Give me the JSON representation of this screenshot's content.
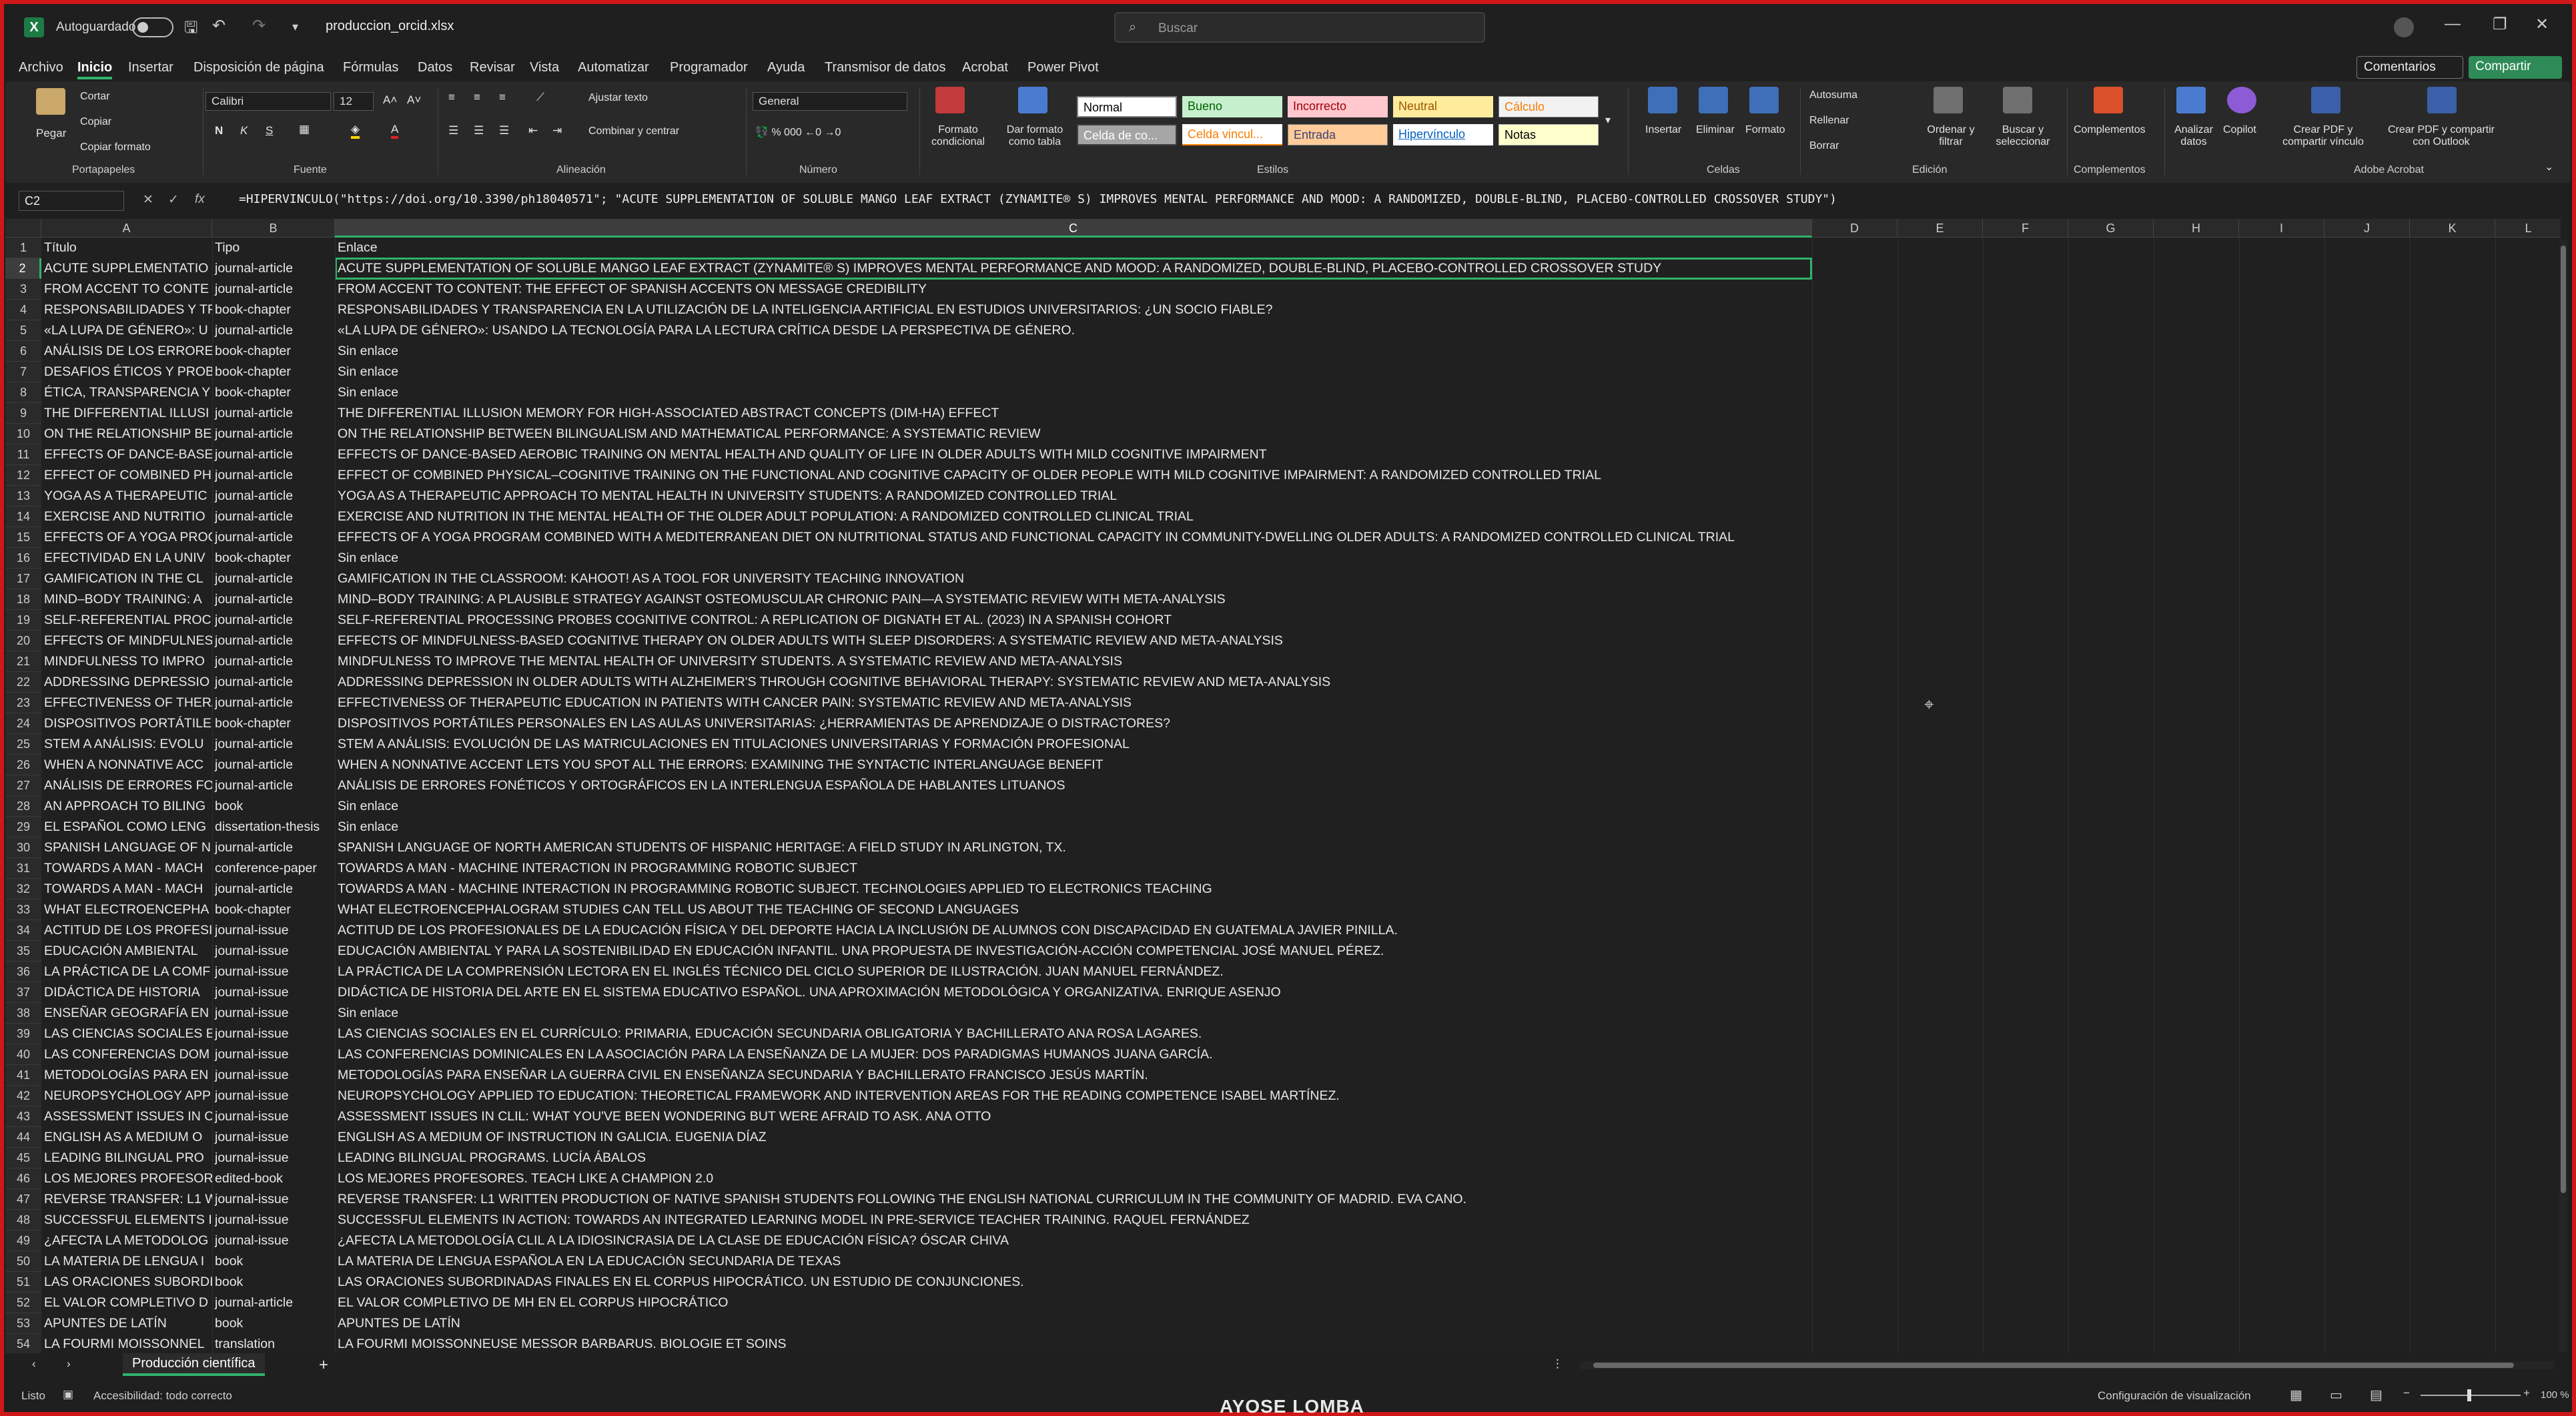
{
  "titlebar": {
    "autosave_label": "Autoguardado",
    "filename": "produccion_orcid.xlsx",
    "search_placeholder": "Buscar"
  },
  "menu": {
    "items": [
      "Archivo",
      "Inicio",
      "Insertar",
      "Disposición de página",
      "Fórmulas",
      "Datos",
      "Revisar",
      "Vista",
      "Automatizar",
      "Programador",
      "Ayuda",
      "Transmisor de datos",
      "Acrobat",
      "Power Pivot"
    ],
    "active": "Inicio",
    "comments_label": "Comentarios",
    "share_label": "Compartir"
  },
  "ribbon": {
    "clipboard": {
      "paste": "Pegar",
      "cut": "Cortar",
      "copy": "Copiar",
      "format_painter": "Copiar formato",
      "label": "Portapapeles"
    },
    "font": {
      "name": "Calibri",
      "size": "12",
      "bold": "N",
      "italic": "K",
      "underline": "S",
      "label": "Fuente"
    },
    "alignment": {
      "wrap": "Ajustar texto",
      "merge": "Combinar y centrar",
      "label": "Alineación"
    },
    "number": {
      "format": "General",
      "label": "Número"
    },
    "styles": {
      "conditional": "Formato condicional",
      "table": "Dar formato como tabla",
      "cells": [
        "Normal",
        "Bueno",
        "Incorrecto",
        "Neutral",
        "Cálculo",
        "Celda de co...",
        "Celda vincul...",
        "Entrada",
        "Hipervínculo",
        "Notas"
      ],
      "label": "Estilos"
    },
    "cells_group": {
      "insert": "Insertar",
      "delete": "Eliminar",
      "format": "Formato",
      "label": "Celdas"
    },
    "editing": {
      "autosum": "Autosuma",
      "fill": "Rellenar",
      "clear": "Borrar",
      "sort": "Ordenar y filtrar",
      "find": "Buscar y seleccionar",
      "label": "Edición"
    },
    "addins": {
      "label": "Complementos",
      "button": "Complementos"
    },
    "analyze": "Analizar datos",
    "copilot": "Copilot",
    "acrobat": {
      "pdf_share": "Crear PDF y compartir vínculo",
      "pdf_outlook": "Crear PDF y compartir con Outlook",
      "label": "Adobe Acrobat"
    }
  },
  "formula_bar": {
    "namebox": "C2",
    "formula": "=HIPERVINCULO(\"https://doi.org/10.3390/ph18040571\"; \"ACUTE SUPPLEMENTATION OF SOLUBLE MANGO LEAF EXTRACT (ZYNAMITE® S) IMPROVES MENTAL PERFORMANCE AND MOOD: A RANDOMIZED, DOUBLE-BLIND, PLACEBO-CONTROLLED CROSSOVER STUDY\")"
  },
  "columns": [
    "A",
    "B",
    "C",
    "D",
    "E",
    "F",
    "G",
    "H",
    "I",
    "J",
    "K",
    "L"
  ],
  "rows": [
    {
      "n": "1",
      "a": "Título",
      "b": "Tipo",
      "c": "Enlace"
    },
    {
      "n": "2",
      "a": "ACUTE SUPPLEMENTATIO",
      "b": "journal-article",
      "c": "ACUTE SUPPLEMENTATION OF SOLUBLE MANGO LEAF EXTRACT (ZYNAMITE® S) IMPROVES MENTAL PERFORMANCE AND MOOD: A RANDOMIZED, DOUBLE-BLIND, PLACEBO-CONTROLLED CROSSOVER STUDY"
    },
    {
      "n": "3",
      "a": "FROM ACCENT TO CONTE",
      "b": "journal-article",
      "c": "FROM ACCENT TO CONTENT: THE EFFECT OF SPANISH ACCENTS ON MESSAGE CREDIBILITY"
    },
    {
      "n": "4",
      "a": "RESPONSABILIDADES Y TF",
      "b": "book-chapter",
      "c": "RESPONSABILIDADES Y TRANSPARENCIA EN LA UTILIZACIÓN DE LA INTELIGENCIA ARTIFICIAL EN ESTUDIOS UNIVERSITARIOS: ¿UN SOCIO FIABLE?"
    },
    {
      "n": "5",
      "a": "«LA LUPA DE GÉNERO»: U",
      "b": "journal-article",
      "c": "«LA LUPA DE GÉNERO»: USANDO LA TECNOLOGÍA PARA LA LECTURA CRÍTICA DESDE LA PERSPECTIVA DE GÉNERO."
    },
    {
      "n": "6",
      "a": "ANÁLISIS DE LOS ERRORE",
      "b": "book-chapter",
      "c": "Sin enlace"
    },
    {
      "n": "7",
      "a": "DESAFIOS ÉTICOS Y PROB",
      "b": "book-chapter",
      "c": "Sin enlace"
    },
    {
      "n": "8",
      "a": "ÉTICA, TRANSPARENCIA Y",
      "b": "book-chapter",
      "c": "Sin enlace"
    },
    {
      "n": "9",
      "a": "THE DIFFERENTIAL ILLUSI",
      "b": "journal-article",
      "c": "THE DIFFERENTIAL ILLUSION MEMORY FOR HIGH-ASSOCIATED ABSTRACT CONCEPTS (DIM-HA) EFFECT"
    },
    {
      "n": "10",
      "a": "ON THE RELATIONSHIP BE",
      "b": "journal-article",
      "c": "ON THE RELATIONSHIP BETWEEN BILINGUALISM AND MATHEMATICAL PERFORMANCE: A SYSTEMATIC REVIEW"
    },
    {
      "n": "11",
      "a": "EFFECTS OF DANCE-BASE",
      "b": "journal-article",
      "c": "EFFECTS OF DANCE-BASED AEROBIC TRAINING ON MENTAL HEALTH AND QUALITY OF LIFE IN OLDER ADULTS WITH MILD COGNITIVE IMPAIRMENT"
    },
    {
      "n": "12",
      "a": "EFFECT OF COMBINED PH",
      "b": "journal-article",
      "c": "EFFECT OF COMBINED PHYSICAL–COGNITIVE TRAINING ON THE FUNCTIONAL AND COGNITIVE CAPACITY OF OLDER PEOPLE WITH MILD COGNITIVE IMPAIRMENT: A RANDOMIZED CONTROLLED TRIAL"
    },
    {
      "n": "13",
      "a": "YOGA AS A THERAPEUTIC",
      "b": "journal-article",
      "c": "YOGA AS A THERAPEUTIC APPROACH TO MENTAL HEALTH IN UNIVERSITY STUDENTS: A RANDOMIZED CONTROLLED TRIAL"
    },
    {
      "n": "14",
      "a": "EXERCISE AND NUTRITIO",
      "b": "journal-article",
      "c": "EXERCISE AND NUTRITION IN THE MENTAL HEALTH OF THE OLDER ADULT POPULATION: A RANDOMIZED CONTROLLED CLINICAL TRIAL"
    },
    {
      "n": "15",
      "a": "EFFECTS OF A YOGA PROG",
      "b": "journal-article",
      "c": "EFFECTS OF A YOGA PROGRAM COMBINED WITH A MEDITERRANEAN DIET ON NUTRITIONAL STATUS AND FUNCTIONAL CAPACITY IN COMMUNITY-DWELLING OLDER ADULTS: A RANDOMIZED CONTROLLED CLINICAL TRIAL"
    },
    {
      "n": "16",
      "a": "EFECTIVIDAD EN LA  UNIV",
      "b": "book-chapter",
      "c": "Sin enlace"
    },
    {
      "n": "17",
      "a": "GAMIFICATION IN THE CL",
      "b": "journal-article",
      "c": "GAMIFICATION IN THE CLASSROOM: KAHOOT! AS A TOOL FOR UNIVERSITY TEACHING INNOVATION"
    },
    {
      "n": "18",
      "a": "MIND–BODY TRAINING: A",
      "b": "journal-article",
      "c": "MIND–BODY TRAINING: A PLAUSIBLE STRATEGY AGAINST OSTEOMUSCULAR CHRONIC PAIN—A SYSTEMATIC REVIEW WITH META-ANALYSIS"
    },
    {
      "n": "19",
      "a": "SELF-REFERENTIAL PROCE",
      "b": "journal-article",
      "c": "SELF-REFERENTIAL PROCESSING PROBES COGNITIVE CONTROL: A REPLICATION OF DIGNATH ET AL. (2023) IN A SPANISH COHORT"
    },
    {
      "n": "20",
      "a": "EFFECTS OF MINDFULNES",
      "b": "journal-article",
      "c": "EFFECTS OF MINDFULNESS-BASED COGNITIVE THERAPY ON OLDER ADULTS WITH SLEEP DISORDERS: A SYSTEMATIC REVIEW AND META-ANALYSIS"
    },
    {
      "n": "21",
      "a": "MINDFULNESS TO IMPRO",
      "b": "journal-article",
      "c": "MINDFULNESS TO IMPROVE THE MENTAL HEALTH OF UNIVERSITY STUDENTS. A SYSTEMATIC REVIEW AND META-ANALYSIS"
    },
    {
      "n": "22",
      "a": "ADDRESSING DEPRESSIO",
      "b": "journal-article",
      "c": "ADDRESSING DEPRESSION IN OLDER ADULTS WITH ALZHEIMER'S THROUGH COGNITIVE BEHAVIORAL THERAPY: SYSTEMATIC REVIEW AND META-ANALYSIS"
    },
    {
      "n": "23",
      "a": "EFFECTIVENESS OF THER/",
      "b": "journal-article",
      "c": "EFFECTIVENESS OF THERAPEUTIC EDUCATION IN PATIENTS WITH CANCER PAIN: SYSTEMATIC REVIEW AND META-ANALYSIS"
    },
    {
      "n": "24",
      "a": " DISPOSITIVOS PORTÁTILE",
      "b": "book-chapter",
      "c": " DISPOSITIVOS PORTÁTILES PERSONALES EN LAS AULAS UNIVERSITARIAS: ¿HERRAMIENTAS DE APRENDIZAJE O DISTRACTORES?"
    },
    {
      "n": "25",
      "a": "STEM A ANÁLISIS: EVOLU",
      "b": "journal-article",
      "c": "STEM A ANÁLISIS: EVOLUCIÓN DE LAS MATRICULACIONES EN TITULACIONES UNIVERSITARIAS Y FORMACIÓN PROFESIONAL"
    },
    {
      "n": "26",
      "a": "WHEN A NONNATIVE ACC",
      "b": "journal-article",
      "c": "WHEN A NONNATIVE ACCENT LETS YOU SPOT ALL THE ERRORS: EXAMINING THE SYNTACTIC INTERLANGUAGE BENEFIT"
    },
    {
      "n": "27",
      "a": "ANÁLISIS DE ERRORES FO",
      "b": "journal-article",
      "c": "ANÁLISIS DE ERRORES FONÉTICOS Y ORTOGRÁFICOS EN LA INTERLENGUA ESPAÑOLA DE HABLANTES LITUANOS"
    },
    {
      "n": "28",
      "a": "AN APPROACH TO BILING",
      "b": "book",
      "c": "Sin enlace"
    },
    {
      "n": "29",
      "a": "EL ESPAÑOL COMO LENG",
      "b": "dissertation-thesis",
      "c": "Sin enlace"
    },
    {
      "n": "30",
      "a": "SPANISH LANGUAGE OF N",
      "b": "journal-article",
      "c": "SPANISH LANGUAGE OF NORTH AMERICAN STUDENTS OF HISPANIC HERITAGE: A FIELD STUDY IN ARLINGTON,   TX."
    },
    {
      "n": "31",
      "a": "TOWARDS A MAN - MACH",
      "b": "conference-paper",
      "c": "TOWARDS A MAN - MACHINE INTERACTION IN PROGRAMMING ROBOTIC SUBJECT"
    },
    {
      "n": "32",
      "a": "TOWARDS A MAN - MACH",
      "b": "journal-article",
      "c": "TOWARDS A MAN - MACHINE INTERACTION IN PROGRAMMING ROBOTIC SUBJECT. TECHNOLOGIES APPLIED TO ELECTRONICS TEACHING"
    },
    {
      "n": "33",
      "a": "WHAT ELECTROENCEPHA",
      "b": "book-chapter",
      "c": "WHAT ELECTROENCEPHALOGRAM STUDIES CAN TELL US ABOUT THE TEACHING OF SECOND LANGUAGES"
    },
    {
      "n": "34",
      "a": "ACTITUD DE LOS PROFESI",
      "b": "journal-issue",
      "c": "ACTITUD DE LOS PROFESIONALES DE LA EDUCACIÓN FÍSICA Y DEL DEPORTE HACIA LA INCLUSIÓN DE ALUMNOS CON DISCAPACIDAD EN GUATEMALA JAVIER PINILLA."
    },
    {
      "n": "35",
      "a": "EDUCACIÓN AMBIENTAL",
      "b": "journal-issue",
      "c": "EDUCACIÓN AMBIENTAL Y PARA LA SOSTENIBILIDAD EN EDUCACIÓN INFANTIL. UNA PROPUESTA DE INVESTIGACIÓN-ACCIÓN COMPETENCIAL JOSÉ MANUEL PÉREZ."
    },
    {
      "n": "36",
      "a": "LA PRÁCTICA DE LA COMF",
      "b": "journal-issue",
      "c": "LA PRÁCTICA DE LA COMPRENSIÓN LECTORA EN EL INGLÉS TÉCNICO DEL CICLO SUPERIOR DE ILUSTRACIÓN. JUAN MANUEL FERNÁNDEZ."
    },
    {
      "n": "37",
      "a": "DIDÁCTICA DE HISTORIA",
      "b": "journal-issue",
      "c": "DIDÁCTICA DE HISTORIA DEL ARTE EN EL SISTEMA EDUCATIVO ESPAÑOL. UNA APROXIMACIÓN METODOLÓGICA Y ORGANIZATIVA. ENRIQUE ASENJO"
    },
    {
      "n": "38",
      "a": "ENSEÑAR GEOGRAFÍA EN",
      "b": "journal-issue",
      "c": "Sin enlace"
    },
    {
      "n": "39",
      "a": "LAS CIENCIAS SOCIALES E",
      "b": "journal-issue",
      "c": "LAS CIENCIAS SOCIALES EN EL CURRÍCULO: PRIMARIA, EDUCACIÓN SECUNDARIA OBLIGATORIA Y BACHILLERATO ANA ROSA LAGARES."
    },
    {
      "n": "40",
      "a": "LAS CONFERENCIAS DOM",
      "b": "journal-issue",
      "c": "LAS CONFERENCIAS DOMINICALES EN LA ASOCIACIÓN PARA LA ENSEÑANZA DE LA MUJER: DOS PARADIGMAS HUMANOS JUANA GARCÍA."
    },
    {
      "n": "41",
      "a": "METODOLOGÍAS PARA EN",
      "b": "journal-issue",
      "c": "METODOLOGÍAS PARA ENSEÑAR LA GUERRA CIVIL EN ENSEÑANZA SECUNDARIA Y BACHILLERATO FRANCISCO JESÚS MARTÍN."
    },
    {
      "n": "42",
      "a": "NEUROPSYCHOLOGY APP",
      "b": "journal-issue",
      "c": "NEUROPSYCHOLOGY APPLIED TO EDUCATION: THEORETICAL FRAMEWORK AND INTERVENTION AREAS FOR THE READING COMPETENCE ISABEL MARTÍNEZ."
    },
    {
      "n": "43",
      "a": "ASSESSMENT ISSUES IN C",
      "b": "journal-issue",
      "c": "ASSESSMENT ISSUES IN CLIL: WHAT YOU'VE BEEN WONDERING BUT WERE AFRAID TO ASK. ANA OTTO"
    },
    {
      "n": "44",
      "a": "ENGLISH AS A MEDIUM O",
      "b": "journal-issue",
      "c": "ENGLISH AS A MEDIUM OF INSTRUCTION IN GALICIA. EUGENIA DÍAZ"
    },
    {
      "n": "45",
      "a": "LEADING BILINGUAL PRO",
      "b": "journal-issue",
      "c": "LEADING BILINGUAL PROGRAMS. LUCÍA ÁBALOS"
    },
    {
      "n": "46",
      "a": "LOS MEJORES PROFESORE",
      "b": "edited-book",
      "c": "LOS MEJORES PROFESORES. TEACH LIKE A CHAMPION 2.0"
    },
    {
      "n": "47",
      "a": "REVERSE TRANSFER: L1 W",
      "b": "journal-issue",
      "c": "REVERSE TRANSFER: L1 WRITTEN PRODUCTION OF NATIVE SPANISH STUDENTS FOLLOWING THE ENGLISH NATIONAL CURRICULUM IN THE COMMUNITY OF MADRID. EVA CANO."
    },
    {
      "n": "48",
      "a": "SUCCESSFUL ELEMENTS II",
      "b": "journal-issue",
      "c": "SUCCESSFUL ELEMENTS IN ACTION: TOWARDS AN INTEGRATED LEARNING MODEL IN PRE-SERVICE TEACHER TRAINING. RAQUEL FERNÁNDEZ"
    },
    {
      "n": "49",
      "a": "¿AFECTA LA METODOLOG",
      "b": "journal-issue",
      "c": "¿AFECTA LA METODOLOGÍA CLIL A LA IDIOSINCRASIA DE LA CLASE DE EDUCACIÓN FÍSICA? ÓSCAR CHIVA"
    },
    {
      "n": "50",
      "a": "LA MATERIA DE LENGUA I",
      "b": "book",
      "c": "LA MATERIA DE LENGUA ESPAÑOLA EN LA EDUCACIÓN SECUNDARIA DE TEXAS"
    },
    {
      "n": "51",
      "a": "LAS ORACIONES SUBORDI",
      "b": "book",
      "c": "LAS ORACIONES SUBORDINADAS FINALES EN EL CORPUS HIPOCRÁTICO. UN ESTUDIO DE CONJUNCIONES."
    },
    {
      "n": "52",
      "a": "EL VALOR COMPLETIVO D",
      "b": "journal-article",
      "c": "EL VALOR COMPLETIVO DE MH EN EL CORPUS HIPOCRÁTICO"
    },
    {
      "n": "53",
      "a": "APUNTES DE LATÍN",
      "b": "book",
      "c": "APUNTES DE LATÍN"
    },
    {
      "n": "54",
      "a": "LA FOURMI MOISSONNEL",
      "b": "translation",
      "c": "LA FOURMI MOISSONNEUSE MESSOR BARBARUS. BIOLOGIE ET SOINS"
    }
  ],
  "sheet_tab": "Producción científica",
  "status": {
    "ready": "Listo",
    "accessibility": "Accesibilidad: todo correcto",
    "display_settings": "Configuración de visualización",
    "zoom": "100 %"
  },
  "brand": "AYOSE LOMBA",
  "colors": {
    "accent": "#2fb36a",
    "frame": "#d01818"
  }
}
